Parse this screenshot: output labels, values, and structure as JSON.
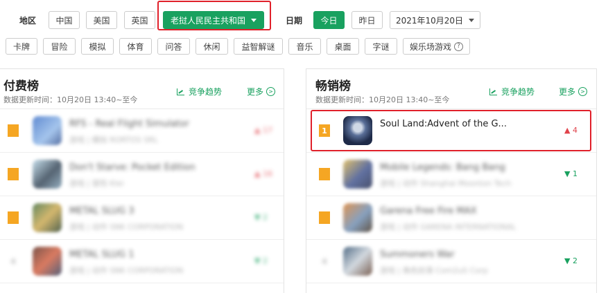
{
  "filters": {
    "region_label": "地区",
    "regions": [
      "中国",
      "美国",
      "英国"
    ],
    "selected_region": "老挝人民民主共和国",
    "date_label": "日期",
    "date_options": [
      "今日",
      "昨日"
    ],
    "date_value": "2021年10月20日"
  },
  "categories": [
    "卡牌",
    "冒险",
    "模拟",
    "体育",
    "问答",
    "休闲",
    "益智解谜",
    "音乐",
    "桌面",
    "字谜",
    "娱乐场游戏"
  ],
  "paid": {
    "title": "付费榜",
    "update": "数据更新时间：10月20日 13:40~至今",
    "trend": "竞争趋势",
    "more": "更多",
    "rows": [
      {
        "rank": "1",
        "name": "RFS - Real Flight Simulator",
        "sub": "游戏 | 模拟   RORTOS SRL",
        "change": "17",
        "dir": "up"
      },
      {
        "rank": "2",
        "name": "Don't Starve: Pocket Edition",
        "sub": "游戏 | 冒险   Klei",
        "change": "16",
        "dir": "up"
      },
      {
        "rank": "3",
        "name": "METAL SLUG 3",
        "sub": "游戏 | 动作   SNK CORPORATION",
        "change": "2",
        "dir": "down"
      },
      {
        "rank": "4",
        "name": "METAL SLUG 1",
        "sub": "游戏 | 动作   SNK CORPORATION",
        "change": "2",
        "dir": "down"
      }
    ]
  },
  "grossing": {
    "title": "畅销榜",
    "update": "数据更新时间：10月20日 13:40~至今",
    "trend": "竞争趋势",
    "more": "更多",
    "rows": [
      {
        "rank": "1",
        "name": "Soul Land:Advent of the G...",
        "sub": "",
        "change": "4",
        "dir": "up"
      },
      {
        "rank": "2",
        "name": "Mobile Legends: Bang Bang",
        "sub": "游戏 | 动作   Shanghai Moonton Tech",
        "change": "1",
        "dir": "down"
      },
      {
        "rank": "3",
        "name": "Garena Free Fire MAX",
        "sub": "游戏 | 动作   GARENA INTERNATIONAL",
        "change": "",
        "dir": ""
      },
      {
        "rank": "4",
        "name": "Summoners War",
        "sub": "游戏 | 角色扮演   Com2uS Corp",
        "change": "2",
        "dir": "down"
      }
    ]
  }
}
